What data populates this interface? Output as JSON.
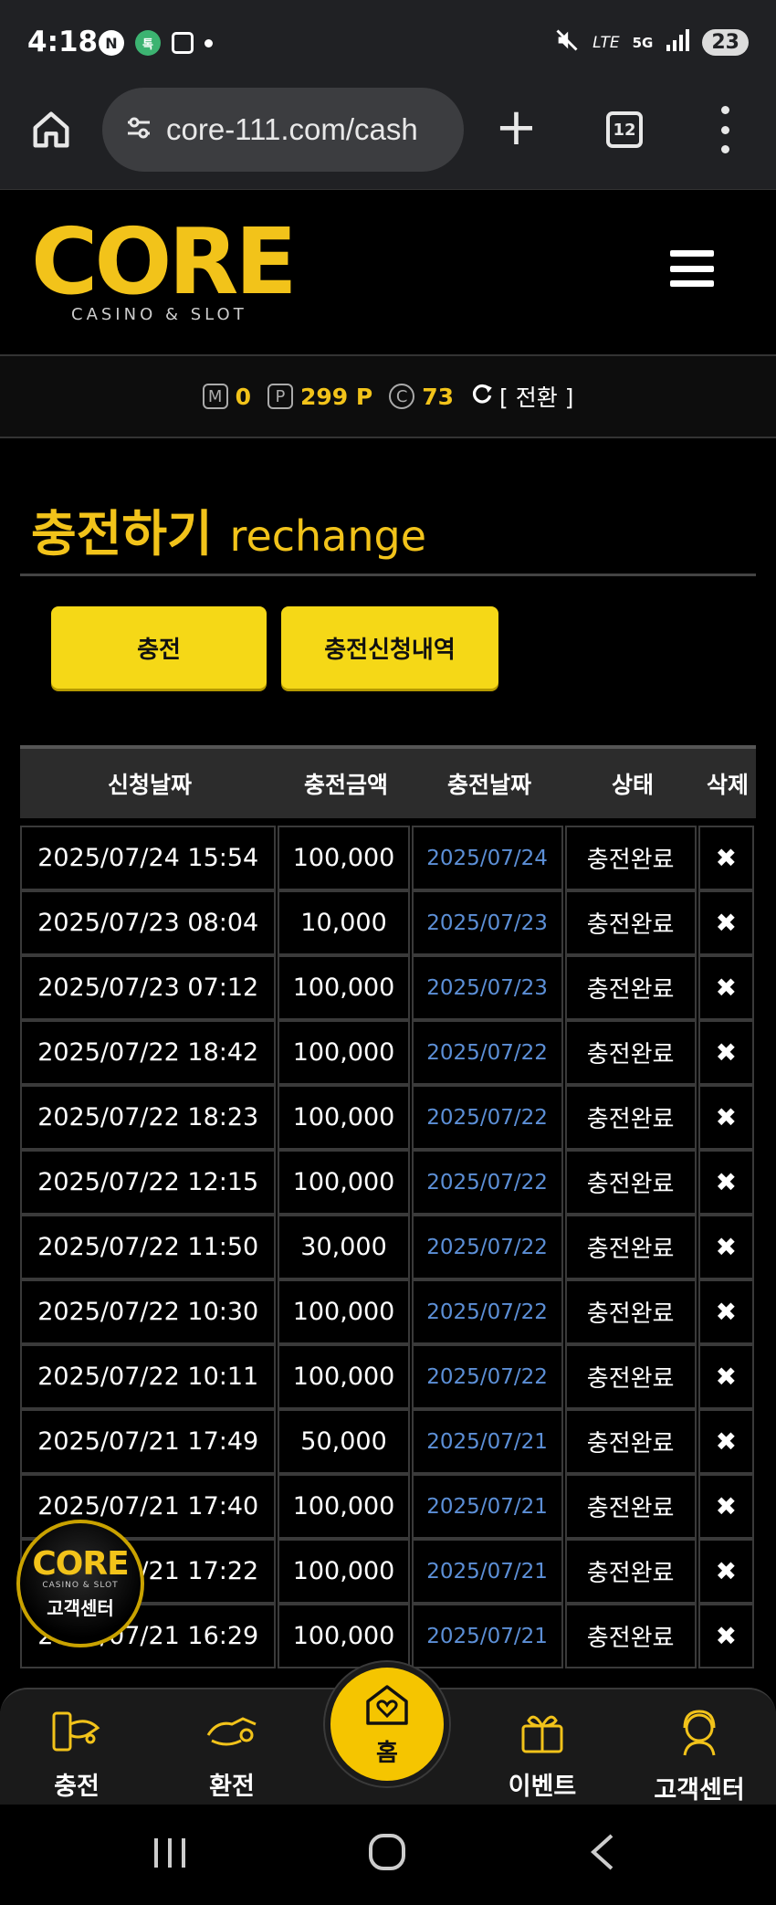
{
  "status_bar": {
    "time": "4:18",
    "left_icons": [
      "naver-icon",
      "kakao-icon",
      "screenshot-icon"
    ],
    "signal_text": "LTE",
    "network": "5G",
    "battery": "23"
  },
  "browser": {
    "url": "core-111.com/cash",
    "tab_count": "12"
  },
  "site": {
    "logo_text": "CORE",
    "logo_sub": "CASINO & SLOT"
  },
  "points": {
    "m_badge": "M",
    "m_value": "0",
    "p_badge": "P",
    "p_value": "299 P",
    "c_badge": "C",
    "c_value": "73",
    "convert_label": "[ 전환 ]",
    "accent_color": "#f2c31a"
  },
  "page": {
    "title_ko": "충전하기",
    "title_en": "rechange"
  },
  "buttons": {
    "charge": "충전",
    "history": "충전신청내역"
  },
  "table": {
    "headers": [
      "신청날짜",
      "충전금액",
      "충전날짜",
      "상태",
      "삭제"
    ],
    "rows": [
      {
        "req": "2025/07/24 15:54",
        "amount": "100,000",
        "date": "2025/07/24",
        "status": "충전완료",
        "del": "✖"
      },
      {
        "req": "2025/07/23 08:04",
        "amount": "10,000",
        "date": "2025/07/23",
        "status": "충전완료",
        "del": "✖"
      },
      {
        "req": "2025/07/23 07:12",
        "amount": "100,000",
        "date": "2025/07/23",
        "status": "충전완료",
        "del": "✖"
      },
      {
        "req": "2025/07/22 18:42",
        "amount": "100,000",
        "date": "2025/07/22",
        "status": "충전완료",
        "del": "✖"
      },
      {
        "req": "2025/07/22 18:23",
        "amount": "100,000",
        "date": "2025/07/22",
        "status": "충전완료",
        "del": "✖"
      },
      {
        "req": "2025/07/22 12:15",
        "amount": "100,000",
        "date": "2025/07/22",
        "status": "충전완료",
        "del": "✖"
      },
      {
        "req": "2025/07/22 11:50",
        "amount": "30,000",
        "date": "2025/07/22",
        "status": "충전완료",
        "del": "✖"
      },
      {
        "req": "2025/07/22 10:30",
        "amount": "100,000",
        "date": "2025/07/22",
        "status": "충전완료",
        "del": "✖"
      },
      {
        "req": "2025/07/22 10:11",
        "amount": "100,000",
        "date": "2025/07/22",
        "status": "충전완료",
        "del": "✖"
      },
      {
        "req": "2025/07/21 17:49",
        "amount": "50,000",
        "date": "2025/07/21",
        "status": "충전완료",
        "del": "✖"
      },
      {
        "req": "2025/07/21 17:40",
        "amount": "100,000",
        "date": "2025/07/21",
        "status": "충전완료",
        "del": "✖"
      },
      {
        "req": "2025/07/21 17:22",
        "amount": "100,000",
        "date": "2025/07/21",
        "status": "충전완료",
        "del": "✖"
      },
      {
        "req": "2025/07/21 16:29",
        "amount": "100,000",
        "date": "2025/07/21",
        "status": "충전완료",
        "del": "✖"
      }
    ]
  },
  "float_badge": {
    "logo": "CORE",
    "sub": "CASINO & SLOT",
    "label": "고객센터"
  },
  "bottom_nav": {
    "charge": "충전",
    "exchange": "환전",
    "home": "홈",
    "event": "이벤트",
    "support": "고객센터"
  }
}
